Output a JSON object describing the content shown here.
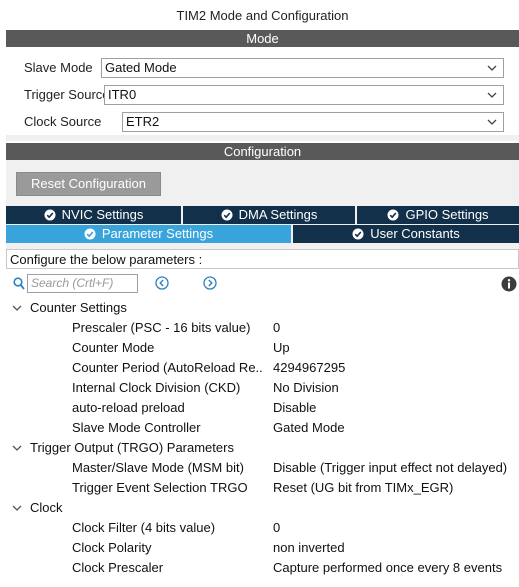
{
  "window": {
    "title": "TIM2 Mode and Configuration"
  },
  "mode": {
    "header": "Mode",
    "fields": [
      {
        "label": "Slave Mode",
        "value": "Gated Mode"
      },
      {
        "label": "Trigger Source",
        "value": "ITR0"
      },
      {
        "label": "Clock Source",
        "value": "ETR2"
      }
    ]
  },
  "configuration": {
    "header": "Configuration",
    "reset_button": "Reset Configuration",
    "tabs_row1": [
      "NVIC Settings",
      "DMA Settings",
      "GPIO Settings"
    ],
    "tabs_row2": [
      "Parameter Settings",
      "User Constants"
    ],
    "active_tab": "Parameter Settings",
    "description": "Configure the below parameters :",
    "search_placeholder": "Search (Crtl+F)",
    "groups": [
      {
        "name": "Counter Settings",
        "params": [
          {
            "name": "Prescaler (PSC - 16 bits value)",
            "value": "0"
          },
          {
            "name": "Counter Mode",
            "value": "Up"
          },
          {
            "name": "Counter Period (AutoReload Re...",
            "value": "4294967295"
          },
          {
            "name": "Internal Clock Division (CKD)",
            "value": "No Division"
          },
          {
            "name": "auto-reload preload",
            "value": "Disable"
          },
          {
            "name": "Slave Mode Controller",
            "value": "Gated Mode"
          }
        ]
      },
      {
        "name": "Trigger Output (TRGO) Parameters",
        "params": [
          {
            "name": "Master/Slave Mode (MSM bit)",
            "value": "Disable (Trigger input effect not delayed)"
          },
          {
            "name": "Trigger Event Selection TRGO",
            "value": "Reset (UG bit from TIMx_EGR)"
          }
        ]
      },
      {
        "name": "Clock",
        "params": [
          {
            "name": "Clock Filter (4 bits value)",
            "value": "0"
          },
          {
            "name": "Clock Polarity",
            "value": "non inverted"
          },
          {
            "name": "Clock Prescaler",
            "value": "Capture performed once every 8 events"
          }
        ]
      }
    ]
  },
  "icons": [
    "chevron-down-icon",
    "check-circle-icon",
    "search-icon",
    "nav-back-icon",
    "nav-forward-icon",
    "info-icon",
    "caret-down-icon"
  ],
  "colors": {
    "section_bar": "#595959",
    "tab_dark": "#12304a",
    "tab_active": "#39a4db",
    "button": "#9a9a9a"
  }
}
